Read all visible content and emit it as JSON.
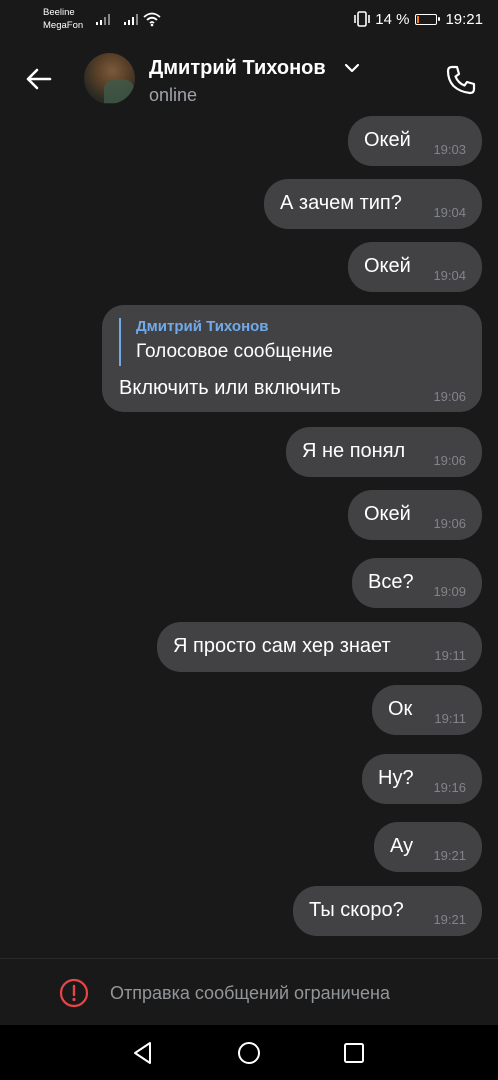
{
  "status_bar": {
    "carrier1": "Beeline",
    "carrier2": "MegaFon",
    "battery_text": "14 %",
    "battery_level": 0.14,
    "time": "19:21"
  },
  "header": {
    "contact_name": "Дмитрий Тихонов",
    "status": "online"
  },
  "messages": [
    {
      "text": "Окей",
      "time": "19:03"
    },
    {
      "text": "А зачем тип?",
      "time": "19:04"
    },
    {
      "text": "Окей",
      "time": "19:04"
    },
    {
      "reply_author": "Дмитрий Тихонов",
      "reply_text": "Голосовое сообщение",
      "text": "Включить или включить",
      "time": "19:06"
    },
    {
      "text": "Я не понял",
      "time": "19:06"
    },
    {
      "text": "Окей",
      "time": "19:06"
    },
    {
      "text": "Все?",
      "time": "19:09"
    },
    {
      "text": "Я просто сам хер знает",
      "time": "19:11"
    },
    {
      "text": "Ок",
      "time": "19:11"
    },
    {
      "text": "Ну?",
      "time": "19:16"
    },
    {
      "text": "Ау",
      "time": "19:21"
    },
    {
      "text": "Ты скоро?",
      "time": "19:21"
    }
  ],
  "footer": {
    "restriction_text": "Отправка сообщений ограничена"
  },
  "colors": {
    "background": "#19191a",
    "bubble": "#424244",
    "accent": "#71aaeb",
    "warning": "#e64646"
  },
  "icons": [
    "back-arrow-icon",
    "chevron-down-icon",
    "phone-icon",
    "warning-icon",
    "nav-back-icon",
    "nav-home-icon",
    "nav-recents-icon"
  ]
}
